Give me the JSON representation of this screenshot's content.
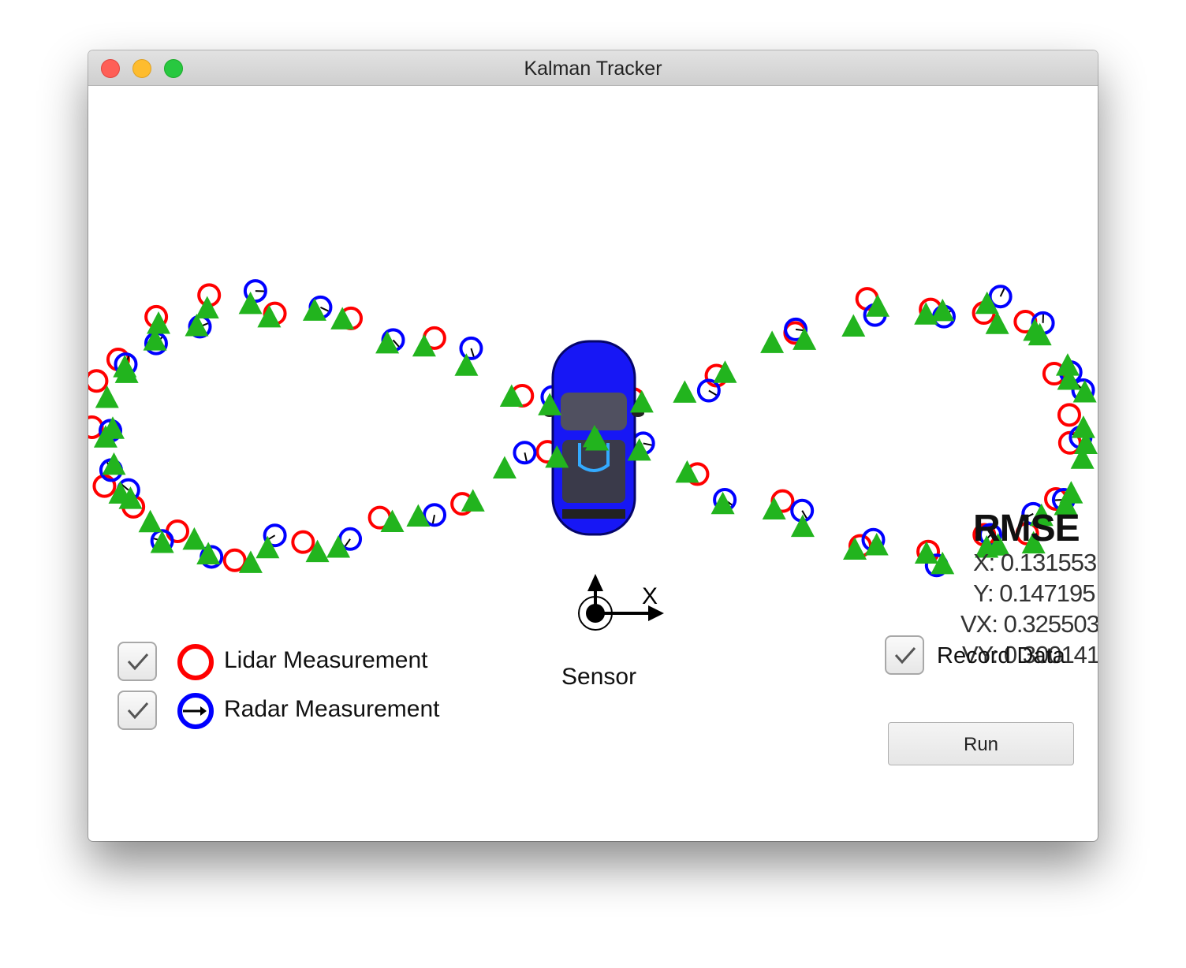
{
  "window": {
    "title": "Kalman Tracker"
  },
  "legend": {
    "lidar_label": "Lidar Measurement",
    "radar_label": "Radar Measurement",
    "lidar_checked": true,
    "radar_checked": true
  },
  "controls": {
    "record_label": "Record Data",
    "record_checked": true,
    "run_label": "Run"
  },
  "rmse": {
    "title": "RMSE",
    "x": "X: 0.131553",
    "y": "Y: 0.147195",
    "vx": "VX: 0.325503",
    "vy": "VY: 0.300141"
  },
  "sensor": {
    "label": "Sensor",
    "axis_x_label": "X"
  },
  "colors": {
    "lidar": "#ff0000",
    "radar": "#0000ff",
    "estimate": "#22b41e",
    "car": "#1a1aff"
  },
  "icons": {
    "lidar_marker": "red-circle-icon",
    "radar_marker": "blue-circle-arrow-icon",
    "estimate_marker": "green-triangle-icon",
    "vehicle": "car-icon",
    "sensor": "sensor-origin-icon"
  }
}
